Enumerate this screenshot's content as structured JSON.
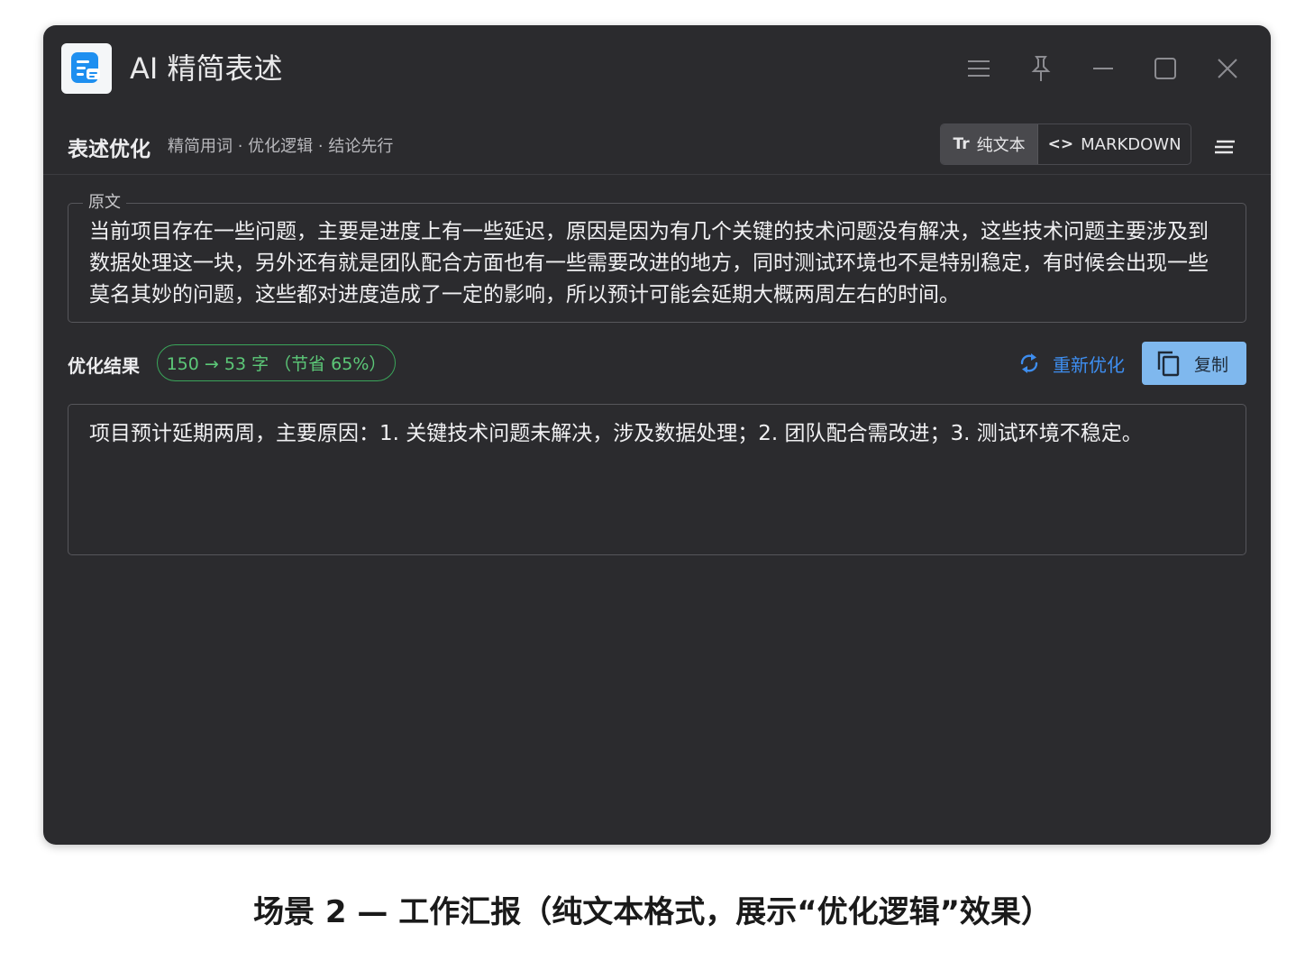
{
  "window": {
    "title": "AI 精简表述",
    "controls": [
      "menu",
      "pin",
      "minimize",
      "maximize",
      "close"
    ]
  },
  "toolbar": {
    "mode_title": "表述优化",
    "mode_subtitle": "精简用词 · 优化逻辑 · 结论先行",
    "format_plain_icon": "Tr",
    "format_plain_label": "纯文本",
    "format_markdown_icon": "<>",
    "format_markdown_label": "MARKDOWN",
    "selected_format": "纯文本"
  },
  "original": {
    "legend": "原文",
    "text": "当前项目存在一些问题，主要是进度上有一些延迟，原因是因为有几个关键的技术问题没有解决，这些技术问题主要涉及到数据处理这一块，另外还有就是团队配合方面也有一些需要改进的地方，同时测试环境也不是特别稳定，有时候会出现一些莫名其妙的问题，这些都对进度造成了一定的影响，所以预计可能会延期大概两周左右的时间。"
  },
  "result": {
    "label": "优化结果",
    "count_badge": "150 → 53 字 （节省 65%）",
    "regenerate_label": "重新优化",
    "copy_label": "复制",
    "text": "项目预计延期两周，主要原因：1. 关键技术问题未解决，涉及数据处理；2. 团队配合需改进；3. 测试环境不稳定。"
  },
  "caption": "场景 2 — 工作汇报（纯文本格式，展示“优化逻辑”效果）",
  "colors": {
    "window_bg": "#2b2b2e",
    "accent_blue": "#3e8ef0",
    "copy_button_bg": "#7fb8ee",
    "badge_green": "#5cc878"
  },
  "icons": [
    "app-logo-icon",
    "hamburger-icon",
    "pin-icon",
    "minimize-icon",
    "maximize-icon",
    "close-icon",
    "refresh-icon",
    "copy-icon",
    "align-lines-icon"
  ]
}
